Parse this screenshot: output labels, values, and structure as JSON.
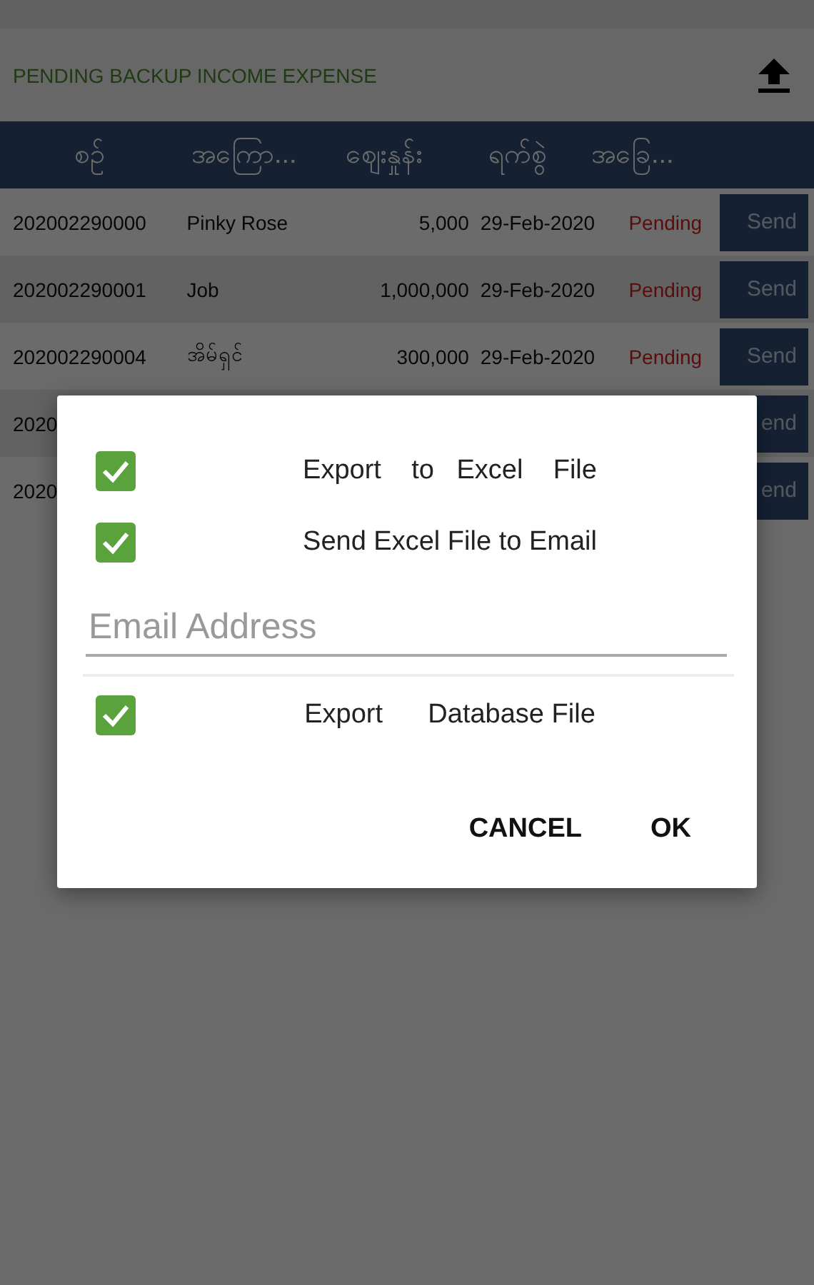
{
  "toolbar": {
    "title": "PENDING BACKUP INCOME EXPENSE"
  },
  "table": {
    "columns": [
      "စဉ်",
      "အကြော...",
      "ဈေးနှုန်း",
      "ရက်စွဲ",
      "အခြေ..."
    ],
    "rows": [
      {
        "id": "202002290000",
        "name": "Pinky Rose",
        "amount": "5,000",
        "date": "29-Feb-2020",
        "status": "Pending",
        "action": "Send"
      },
      {
        "id": "202002290001",
        "name": "Job",
        "amount": "1,000,000",
        "date": "29-Feb-2020",
        "status": "Pending",
        "action": "Send"
      },
      {
        "id": "202002290004",
        "name": "အိမ်ရှင်",
        "amount": "300,000",
        "date": "29-Feb-2020",
        "status": "Pending",
        "action": "Send"
      },
      {
        "id": "2020",
        "action": "end"
      },
      {
        "id": "2020",
        "action": "end"
      }
    ]
  },
  "dialog": {
    "options": [
      {
        "label": "Export    to   Excel    File",
        "checked": true
      },
      {
        "label": "Send Excel File to Email",
        "checked": true
      }
    ],
    "email": {
      "placeholder": "Email Address"
    },
    "options_after": [
      {
        "label": "Export      Database File",
        "checked": true
      }
    ],
    "buttons": [
      "CANCEL",
      "OK"
    ]
  }
}
